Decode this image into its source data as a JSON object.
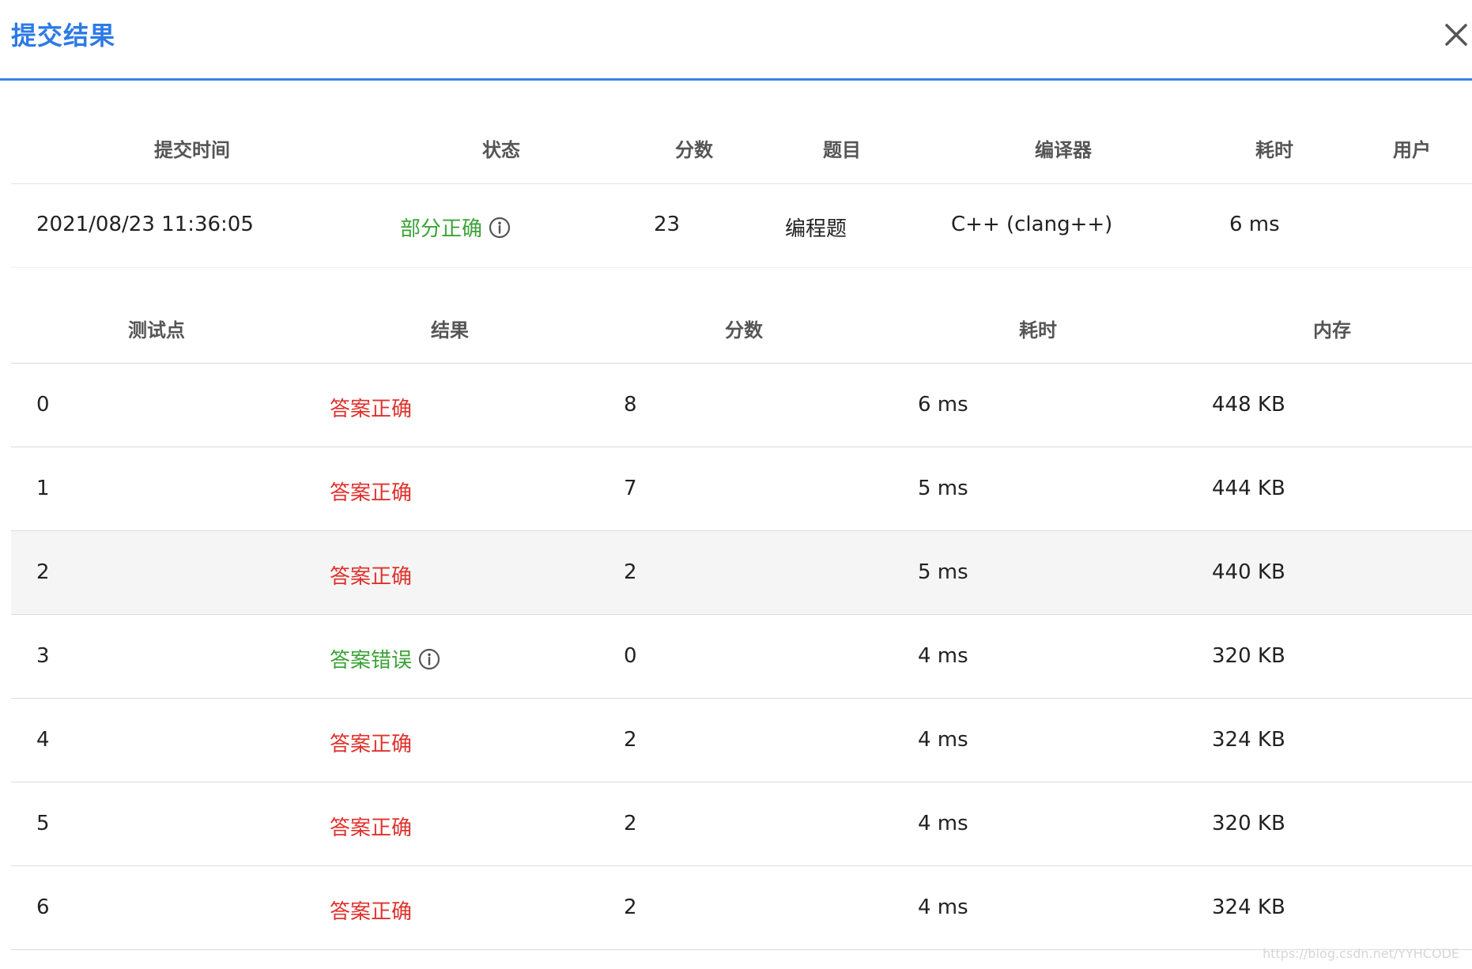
{
  "dialog": {
    "title": "提交结果"
  },
  "summary": {
    "headers": [
      "提交时间",
      "状态",
      "分数",
      "题目",
      "编译器",
      "耗时",
      "用户"
    ],
    "row": {
      "time": "2021/08/23 11:36:05",
      "status": "部分正确",
      "score": "23",
      "problem": "编程题",
      "compiler": "C++ (clang++)",
      "duration": "6 ms",
      "user": ""
    }
  },
  "testcases": {
    "headers": [
      "测试点",
      "结果",
      "分数",
      "耗时",
      "内存"
    ],
    "rows": [
      {
        "id": "0",
        "result": "答案正确",
        "score": "8",
        "time": "6 ms",
        "memory": "448 KB"
      },
      {
        "id": "1",
        "result": "答案正确",
        "score": "7",
        "time": "5 ms",
        "memory": "444 KB"
      },
      {
        "id": "2",
        "result": "答案正确",
        "score": "2",
        "time": "5 ms",
        "memory": "440 KB"
      },
      {
        "id": "3",
        "result": "答案错误",
        "score": "0",
        "time": "4 ms",
        "memory": "320 KB"
      },
      {
        "id": "4",
        "result": "答案正确",
        "score": "2",
        "time": "4 ms",
        "memory": "324 KB"
      },
      {
        "id": "5",
        "result": "答案正确",
        "score": "2",
        "time": "4 ms",
        "memory": "320 KB"
      },
      {
        "id": "6",
        "result": "答案正确",
        "score": "2",
        "time": "4 ms",
        "memory": "324 KB"
      }
    ]
  },
  "colors": {
    "accent": "#2d7ae6",
    "correct": "#e0312c",
    "wrong": "#3aa336",
    "highlight_row": "#f5f5f5"
  },
  "watermark": "https://blog.csdn.net/YYHCODE"
}
